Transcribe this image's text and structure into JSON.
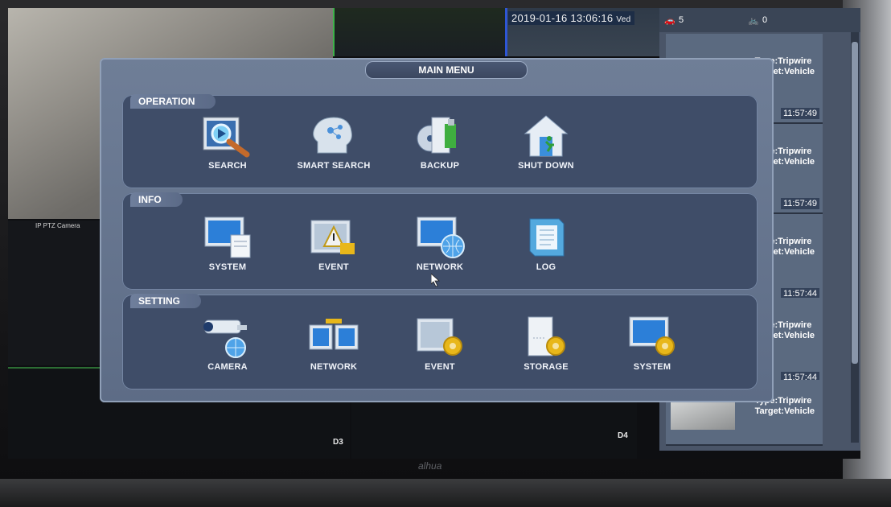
{
  "overlay": {
    "datetime": "2019-01-16 13:06:16",
    "datetime_suffix": "Ved",
    "ptz_label": "IP PTZ Camera",
    "channel_labels": [
      "D3",
      "D4"
    ],
    "car_count": "5",
    "bike_count": "0",
    "brand": "alhua"
  },
  "main_menu": {
    "title": "MAIN MENU",
    "operation": {
      "label": "OPERATION",
      "items": [
        {
          "label": "SEARCH",
          "icon": "search-icon"
        },
        {
          "label": "SMART SEARCH",
          "icon": "smart-search-icon"
        },
        {
          "label": "BACKUP",
          "icon": "backup-icon"
        },
        {
          "label": "SHUT DOWN",
          "icon": "shutdown-icon"
        }
      ]
    },
    "info": {
      "label": "INFO",
      "items": [
        {
          "label": "SYSTEM",
          "icon": "system-info-icon"
        },
        {
          "label": "EVENT",
          "icon": "event-info-icon"
        },
        {
          "label": "NETWORK",
          "icon": "network-info-icon"
        },
        {
          "label": "LOG",
          "icon": "log-icon"
        }
      ]
    },
    "setting": {
      "label": "SETTING",
      "items": [
        {
          "label": "CAMERA",
          "icon": "camera-setting-icon"
        },
        {
          "label": "NETWORK",
          "icon": "network-setting-icon"
        },
        {
          "label": "EVENT",
          "icon": "event-setting-icon"
        },
        {
          "label": "STORAGE",
          "icon": "storage-setting-icon"
        },
        {
          "label": "SYSTEM",
          "icon": "system-setting-icon"
        }
      ]
    }
  },
  "events": [
    {
      "type": "Type:Tripwire",
      "target": "Target:Vehicle",
      "time": "11:57:49"
    },
    {
      "type": "Type:Tripwire",
      "target": "Target:Vehicle",
      "time": "11:57:49"
    },
    {
      "type": "Type:Tripwire",
      "target": "Target:Vehicle",
      "time": "11:57:44"
    },
    {
      "type": "Type:Tripwire",
      "target": "Target:Vehicle",
      "time": "11:57:44"
    },
    {
      "type": "Type:Tripwire",
      "target": "Target:Vehicle",
      "time": ""
    }
  ],
  "colors": {
    "menu_bg": "#6f7e97",
    "section_bg": "#3f4d68",
    "accent_gold": "#e8b71a"
  }
}
